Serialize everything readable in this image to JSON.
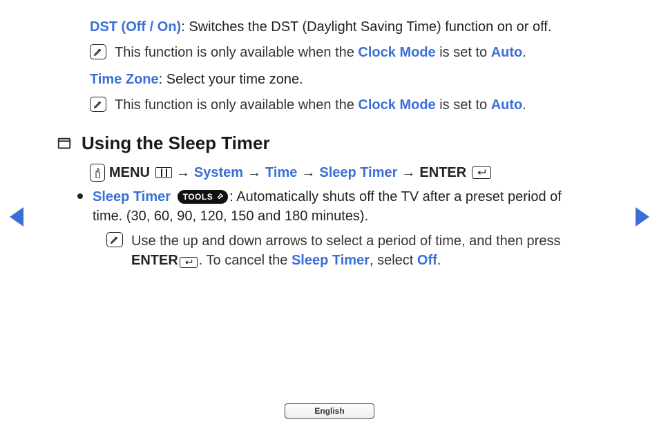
{
  "top": {
    "dst_label": "DST (Off / On)",
    "dst_desc": ": Switches the DST (Daylight Saving Time) function on or off.",
    "note1_prefix": "This function is only available when the ",
    "note1_mid": " is set to ",
    "note1_clockmode": "Clock Mode",
    "note1_auto": "Auto",
    "note1_suffix": ".",
    "timezone_label": "Time Zone",
    "timezone_desc": ": Select your time zone.",
    "note2_prefix": "This function is only available when the ",
    "note2_clockmode": "Clock Mode",
    "note2_mid": " is set to ",
    "note2_auto": "Auto",
    "note2_suffix": "."
  },
  "section": {
    "title": "Using the Sleep Timer"
  },
  "crumb": {
    "menu": "MENU",
    "arrow": "→",
    "system": "System",
    "time": "Time",
    "sleep_timer": "Sleep Timer",
    "enter": "ENTER"
  },
  "bullet": {
    "label": "Sleep Timer",
    "tools": "TOOLS",
    "body_a": ": Automatically shuts off the TV after a preset period of time. (30, 60, 90, 120, 150 and 180 minutes)."
  },
  "subnote": {
    "a": "Use the up and down arrows to select a period of time, and then press ",
    "enter": "ENTER",
    "b": ". To cancel the ",
    "sleep_timer": "Sleep Timer",
    "c": ", select ",
    "off": "Off",
    "d": "."
  },
  "footer": {
    "language": "English"
  }
}
